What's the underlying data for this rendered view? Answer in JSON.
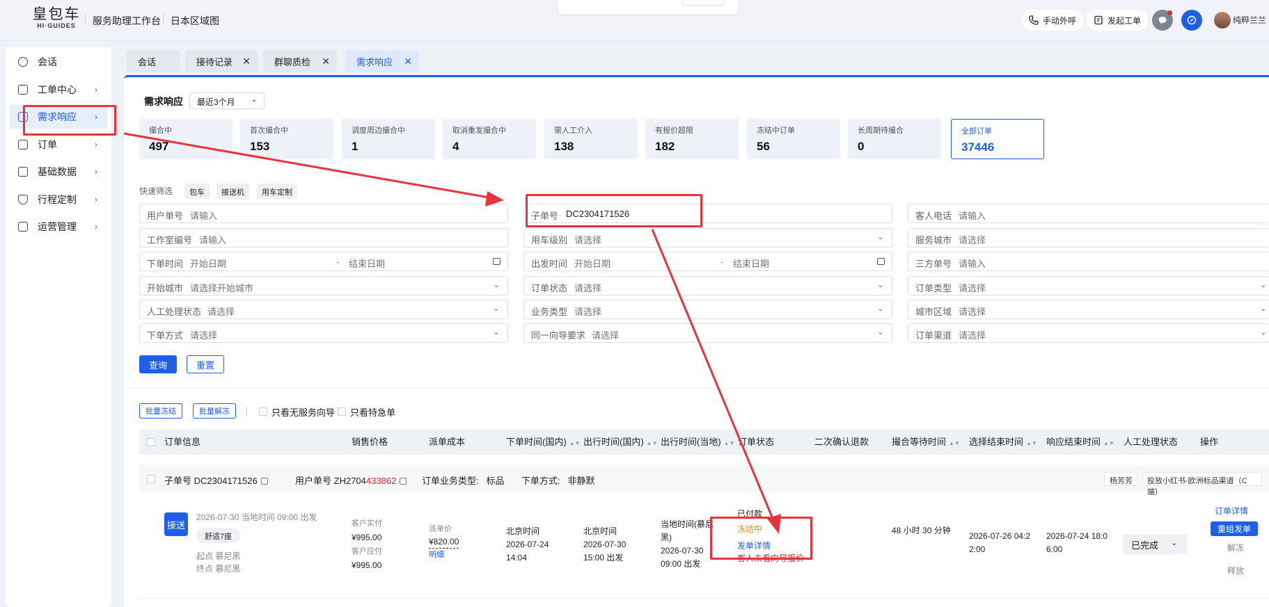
{
  "brand": {
    "logo_cn": "皇包车",
    "logo_en": "HI·GUIDES"
  },
  "topbar": {
    "nav": [
      "服务助理工作台",
      "日本区域图"
    ],
    "manual_call": "手动外呼",
    "create_ticket": "发起工单",
    "user_name": "纯粹兰兰"
  },
  "sidebar": {
    "items": [
      {
        "label": "会话"
      },
      {
        "label": "工单中心"
      },
      {
        "label": "需求响应"
      },
      {
        "label": "订单"
      },
      {
        "label": "基础数据"
      },
      {
        "label": "行程定制"
      },
      {
        "label": "运营管理"
      }
    ]
  },
  "tabs": [
    {
      "label": "会话"
    },
    {
      "label": "接待记录"
    },
    {
      "label": "群聊质检"
    },
    {
      "label": "需求响应"
    }
  ],
  "header": {
    "title": "需求响应",
    "period": "最近3个月"
  },
  "stats": [
    {
      "label": "撮合中",
      "value": "497"
    },
    {
      "label": "首次撮合中",
      "value": "153"
    },
    {
      "label": "调度周边撮合中",
      "value": "1"
    },
    {
      "label": "取消重发撮合中",
      "value": "4"
    },
    {
      "label": "需人工介入",
      "value": "138"
    },
    {
      "label": "有报价超限",
      "value": "182"
    },
    {
      "label": "冻结中订单",
      "value": "56"
    },
    {
      "label": "长周期待撮合",
      "value": "0"
    },
    {
      "label": "全部订单",
      "value": "37446"
    }
  ],
  "quick_filter": {
    "label": "快速筛选",
    "chips": [
      "包车",
      "接送机",
      "用车定制"
    ]
  },
  "filters": {
    "user_order": {
      "label": "用户单号",
      "placeholder": "请输入"
    },
    "sub_order": {
      "label": "子单号",
      "value": "DC2304171526"
    },
    "guest_phone": {
      "label": "客人电话",
      "placeholder": "请输入"
    },
    "studio_no": {
      "label": "工作室编号",
      "placeholder": "请输入"
    },
    "car_level": {
      "label": "用车级别",
      "placeholder": "请选择"
    },
    "service_city": {
      "label": "服务城市",
      "placeholder": "请选择"
    },
    "order_time": {
      "label": "下单时间",
      "start": "开始日期",
      "sep": "-",
      "end": "结束日期"
    },
    "depart_time": {
      "label": "出发时间",
      "start": "开始日期",
      "sep": "-",
      "end": "结束日期"
    },
    "third_no": {
      "label": "三方单号",
      "placeholder": "请输入"
    },
    "start_city": {
      "label": "开始城市",
      "placeholder": "请选择开始城市"
    },
    "order_status": {
      "label": "订单状态",
      "placeholder": "请选择"
    },
    "order_type": {
      "label": "订单类型",
      "placeholder": "请选择"
    },
    "manual_status": {
      "label": "人工处理状态",
      "placeholder": "请选择"
    },
    "biz_type": {
      "label": "业务类型",
      "placeholder": "请选择"
    },
    "city_area": {
      "label": "城市区域",
      "placeholder": "请选择"
    },
    "order_method": {
      "label": "下单方式",
      "placeholder": "请选择"
    },
    "guide_req": {
      "label": "同一向导要求",
      "placeholder": "请选择"
    },
    "channel": {
      "label": "订单渠道",
      "placeholder": "请选择"
    }
  },
  "actions": {
    "query": "查询",
    "reset": "重置"
  },
  "batch": {
    "freeze": "批量冻结",
    "unfreeze": "批量解冻",
    "only_no_guide": "只看无服务向导",
    "only_urgent": "只看特急单"
  },
  "table": {
    "columns": [
      "订单信息",
      "销售价格",
      "派单成本",
      "下单时间(国内)",
      "出行时间(国内)",
      "出行时间(当地)",
      "订单状态",
      "二次确认退款",
      "撮合等待时间",
      "选择结束时间",
      "响应结束时间",
      "人工处理状态",
      "操作"
    ]
  },
  "order": {
    "sub_no_label": "子单号",
    "sub_no": "DC2304171526",
    "user_no_label": "用户单号",
    "user_no_prefix": "ZH2704",
    "user_no_suffix": "433862",
    "biz_type_label": "订单业务类型:",
    "biz_type": "标品",
    "method_label": "下单方式:",
    "method": "非静默",
    "assignee": "杨芳芳",
    "channel_tag": "投放小红书-欧洲标品渠道（C端）",
    "service_type": "接送",
    "trip_time": "2026-07-30 当地时间 09:00 出发",
    "car": "舒适7座",
    "start_point": "起点 慕尼黑",
    "end_point": "终点 慕尼黑",
    "customer_paid_label": "客户实付",
    "customer_paid": "¥995.00",
    "customer_due_label": "客户应付",
    "customer_due": "¥995.00",
    "dispatch_price_label": "派单价",
    "dispatch_price": "¥820.00",
    "detail_link": "明细",
    "order_time_zone": "北京时间",
    "order_time": "2026-07-24 14:04",
    "trip_cn_zone": "北京时间",
    "trip_cn_date": "2026-07-30",
    "trip_cn_time": "15:00 出发",
    "trip_local_zone": "当地时间(慕尼黑)",
    "trip_local_date": "2026-07-30",
    "trip_local_time": "09:00 出发",
    "status_paid": "已付款",
    "status_frozen": "冻结中",
    "status_detail": "发单详情",
    "status_note": "客人未看向导报价",
    "wait_time": "48 小时 30 分钟",
    "select_end_a": "2026-07-26 04:2",
    "select_end_b": "2:00",
    "respond_end_a": "2026-07-24 18:0",
    "respond_end_b": "6:00",
    "manual_status": "已完成",
    "op_detail": "订单详情",
    "op_redispatch": "重组发单",
    "op_unfreeze": "解冻",
    "op_release": "释放"
  },
  "colors": {
    "accent": "#1d5fe6",
    "highlight": "#e8333b",
    "frozen": "#e88c1a",
    "warn": "#e0282e"
  }
}
